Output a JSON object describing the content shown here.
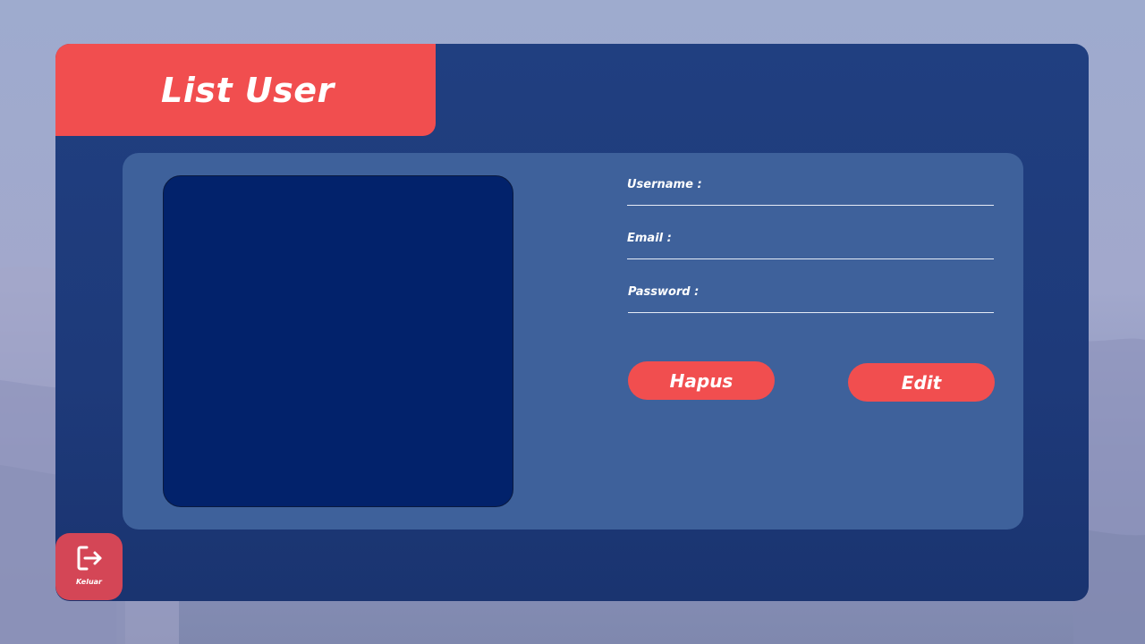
{
  "colors": {
    "background": "#9eabce",
    "panel": "#1e3a7a",
    "card": "#3e619b",
    "photo": "#02226b",
    "accent": "#f14e4f",
    "logout": "#d44656",
    "text": "#ffffff"
  },
  "header": {
    "title": "List User"
  },
  "form": {
    "username_label": "Username :",
    "username_value": "",
    "email_label": "Email :",
    "email_value": "",
    "password_label": "Password :",
    "password_value": ""
  },
  "actions": {
    "delete_label": "Hapus",
    "edit_label": "Edit"
  },
  "logout": {
    "label": "Keluar",
    "icon": "logout-icon"
  }
}
